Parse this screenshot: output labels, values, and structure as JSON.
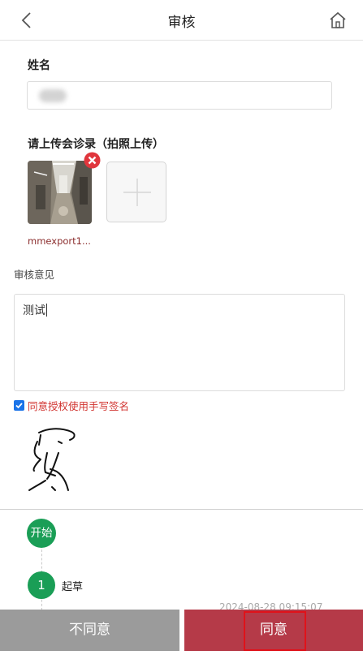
{
  "header": {
    "title": "审核",
    "back_icon": "chevron-left-icon",
    "home_icon": "home-icon"
  },
  "form": {
    "name_label": "姓名",
    "name_value": "",
    "upload_label": "请上传会诊录（拍照上传）",
    "uploaded_file_name": "mmexport1...",
    "remove_icon": "close-circle-icon",
    "add_icon": "plus-icon",
    "review_label": "审核意见",
    "review_value": "测试",
    "authorize_checked": true,
    "authorize_label": "同意授权使用手写签名"
  },
  "workflow": {
    "start_label": "开始",
    "steps": [
      {
        "number": "1",
        "label": "起草",
        "time": "2024-08-28 09:15:07"
      }
    ]
  },
  "actions": {
    "disagree_label": "不同意",
    "agree_label": "同意"
  },
  "colors": {
    "accent_green": "#1a9e56",
    "agree_red": "#b53a48",
    "disagree_gray": "#9b9b9b",
    "link_red": "#d0312d"
  }
}
